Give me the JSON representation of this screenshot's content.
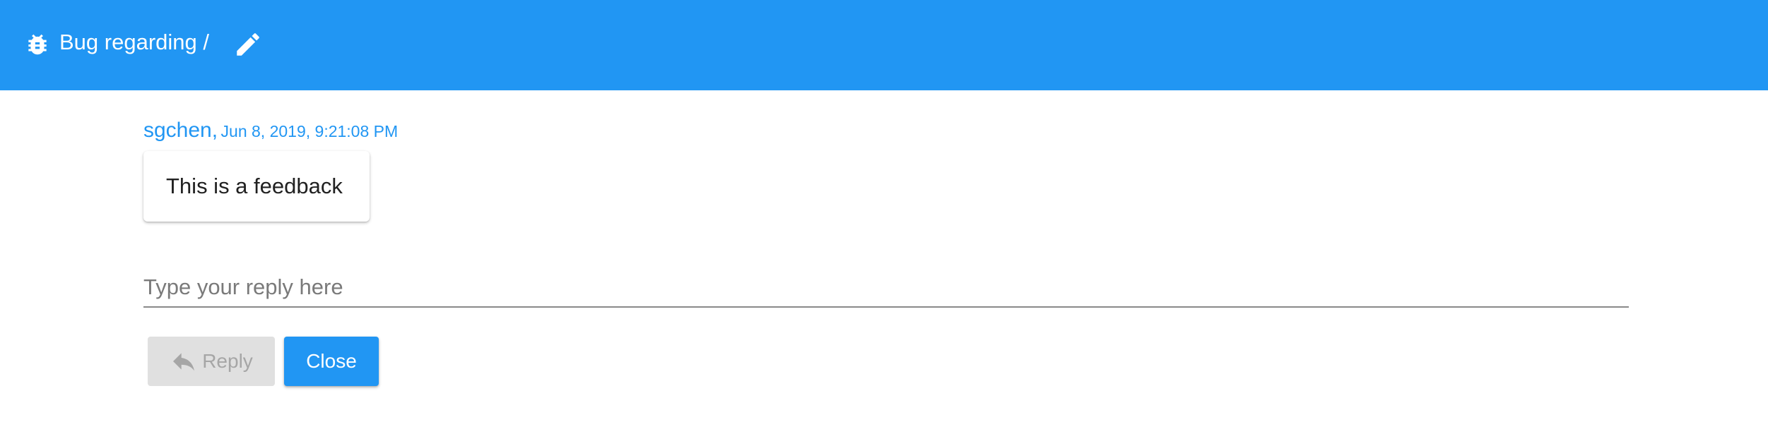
{
  "header": {
    "title": "Bug regarding /",
    "bug_icon": "bug-icon",
    "edit_icon": "pencil-icon",
    "background_color": "#2196f3"
  },
  "message": {
    "author": "sgchen,",
    "date": "Jun 8, 2019, 9:21:08 PM",
    "text": "This is a feedback"
  },
  "reply": {
    "placeholder": "Type your reply here",
    "value": ""
  },
  "actions": {
    "reply_label": "Reply",
    "reply_icon": "reply-arrow-icon",
    "close_label": "Close"
  }
}
